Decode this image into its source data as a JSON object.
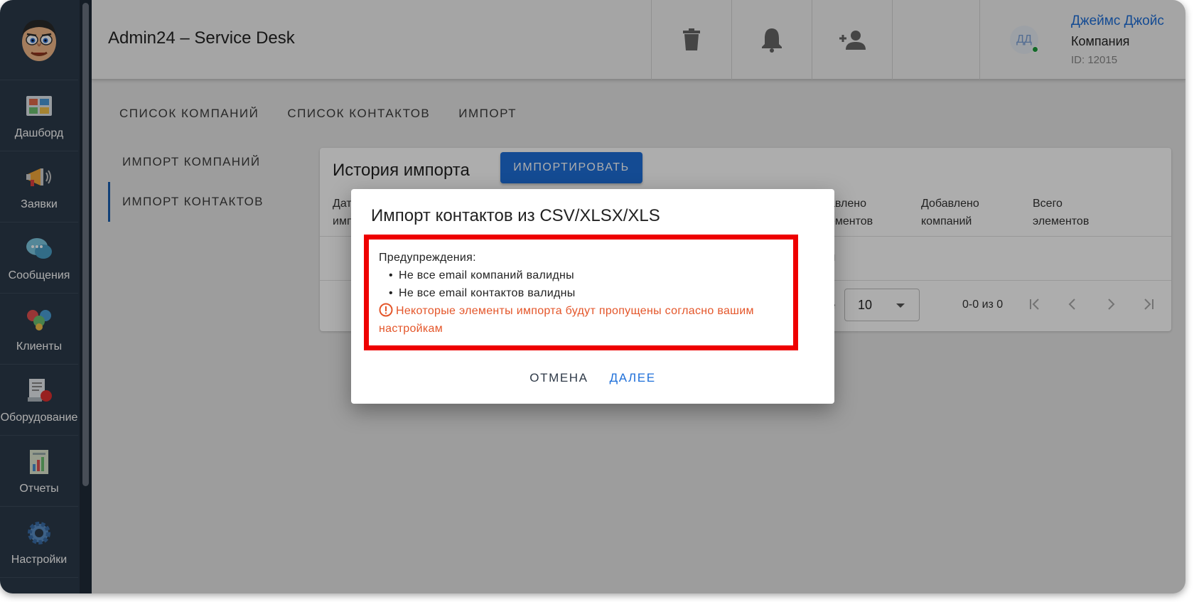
{
  "app": {
    "title": "Admin24 – Service Desk"
  },
  "sidebar": {
    "items": [
      {
        "label": "Дашборд",
        "icon": "dashboard-icon"
      },
      {
        "label": "Заявки",
        "icon": "megaphone-icon"
      },
      {
        "label": "Сообщения",
        "icon": "chat-bubbles-icon"
      },
      {
        "label": "Клиенты",
        "icon": "clients-icon"
      },
      {
        "label": "Оборудование",
        "icon": "equipment-icon"
      },
      {
        "label": "Отчеты",
        "icon": "report-icon"
      },
      {
        "label": "Настройки",
        "icon": "settings-gear-icon"
      }
    ]
  },
  "header": {
    "user": {
      "initials": "ДД",
      "name": "Джеймс Джойс",
      "company": "Компания",
      "id": "ID: 12015"
    }
  },
  "tabs": [
    "СПИСОК КОМПАНИЙ",
    "СПИСОК КОНТАКТОВ",
    "ИМПОРТ"
  ],
  "subnav": [
    "ИМПОРТ КОМПАНИЙ",
    "ИМПОРТ КОНТАКТОВ"
  ],
  "card": {
    "title": "История импорта",
    "import_button": "ИМПОРТИРОВАТЬ",
    "columns_partial": {
      "col1_line1": "Дат",
      "col1_line2": "имп",
      "col2_line1": "авлено",
      "col2_line2": "ементов",
      "col3_line1": "Добавлено",
      "col3_line2": "компаний",
      "col4_line1": "Всего",
      "col4_line2": "элементов"
    },
    "empty_row_fragment": "н",
    "rows_per_page_fragment": "е",
    "rows_per_page_value": "10",
    "page_info": "0-0 из 0"
  },
  "dialog": {
    "title": "Импорт контактов из CSV/XLSX/XLS",
    "warnings_header": "Предупреждения:",
    "warnings": [
      "Не все email компаний валидны",
      "Не все email контактов валидны"
    ],
    "note": "Некоторые элементы импорта будут пропущены согласно вашим настройкам",
    "cancel_label": "ОТМЕНА",
    "next_label": "ДАЛЕЕ"
  },
  "colors": {
    "accent": "#1e6fd9",
    "sidebar_bg": "#2b3a4a",
    "warning_text": "#e4562a",
    "highlight_border": "#ee0000",
    "online": "#1c9c3c"
  }
}
